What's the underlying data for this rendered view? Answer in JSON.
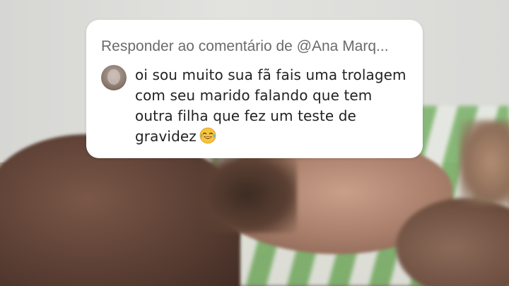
{
  "reply_card": {
    "header": "Responder ao comentário de @Ana Marq...",
    "comment_lines": [
      "oi sou muito sua fã fais uma trolagem",
      "com seu marido falando que tem",
      "outra filha que fez um teste de",
      "gravidez"
    ],
    "emoji_icon": "face-with-tears-of-joy-icon",
    "colors": {
      "card_background": "#ffffff",
      "header_text": "#6b6b6b",
      "comment_text": "#222222",
      "emoji_face": "#f7c33a"
    }
  }
}
